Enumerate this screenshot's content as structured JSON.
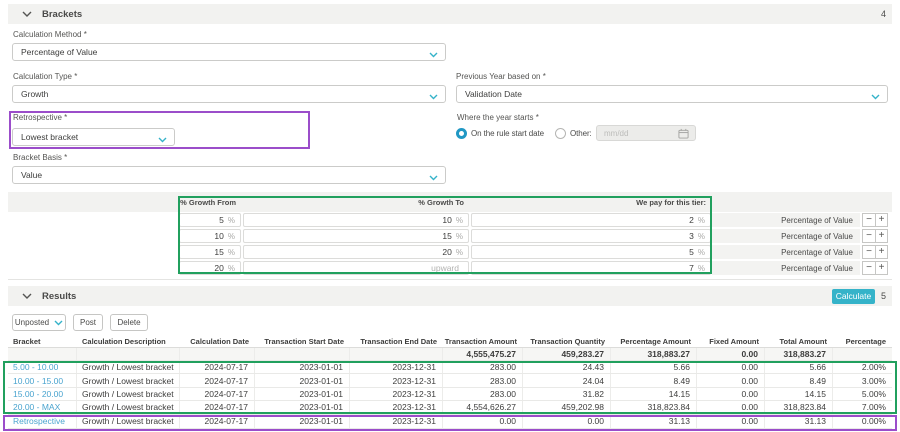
{
  "colors": {
    "accent_teal": "#35b3c9",
    "link_blue": "#4aa4cf",
    "highlight_green": "#21a05e",
    "highlight_purple": "#9b4dca"
  },
  "brackets": {
    "title": "Brackets",
    "count": "4",
    "calculation_method": {
      "label": "Calculation Method *",
      "value": "Percentage of Value"
    },
    "calculation_type": {
      "label": "Calculation Type *",
      "value": "Growth"
    },
    "previous_year": {
      "label": "Previous Year based on *",
      "value": "Validation Date"
    },
    "retrospective": {
      "label": "Retrospective *",
      "value": "Lowest bracket"
    },
    "where_year_starts": {
      "label": "Where the year starts *",
      "option_rule_start": "On the rule start date",
      "option_other": "Other:",
      "date_placeholder": "mm/dd"
    },
    "bracket_basis": {
      "label": "Bracket Basis *",
      "value": "Value"
    },
    "tiers": {
      "col_from": "% Growth From",
      "col_to": "% Growth To",
      "col_pay": "We pay for this tier:",
      "unit": "%",
      "minus": "−",
      "plus": "+",
      "rows": [
        {
          "from": "5",
          "to": "10",
          "to_state": "filled",
          "to_unit": "%",
          "pay": "2",
          "method": "Percentage of Value"
        },
        {
          "from": "10",
          "to": "15",
          "to_state": "filled",
          "to_unit": "%",
          "pay": "3",
          "method": "Percentage of Value"
        },
        {
          "from": "15",
          "to": "20",
          "to_state": "filled",
          "to_unit": "%",
          "pay": "5",
          "method": "Percentage of Value"
        },
        {
          "from": "20",
          "to": "upward",
          "to_state": "placeholder",
          "to_unit": "",
          "pay": "7",
          "method": "Percentage of Value"
        }
      ]
    }
  },
  "results": {
    "title": "Results",
    "count": "5",
    "calculate": "Calculate",
    "status_filter": "Unposted",
    "post": "Post",
    "delete": "Delete",
    "table": {
      "headers": [
        "Bracket",
        "Calculation Description",
        "Calculation Date",
        "Transaction Start Date",
        "Transaction End Date",
        "Transaction Amount",
        "Transaction Quantity",
        "Percentage Amount",
        "Fixed Amount",
        "Total Amount",
        "Percentage"
      ],
      "summary": {
        "transaction_amount": "4,555,475.27",
        "transaction_quantity": "459,283.27",
        "percentage_amount": "318,883.27",
        "fixed_amount": "0.00",
        "total_amount": "318,883.27"
      },
      "rows": [
        {
          "bracket": "5.00 - 10.00",
          "description": "Growth / Lowest bracket",
          "calc_date": "2024-07-17",
          "start_date": "2023-01-01",
          "end_date": "2023-12-31",
          "amount": "283.00",
          "quantity": "24.43",
          "pct_amount": "5.66",
          "fixed": "0.00",
          "total": "5.66",
          "pct": "2.00%"
        },
        {
          "bracket": "10.00 - 15.00",
          "description": "Growth / Lowest bracket",
          "calc_date": "2024-07-17",
          "start_date": "2023-01-01",
          "end_date": "2023-12-31",
          "amount": "283.00",
          "quantity": "24.04",
          "pct_amount": "8.49",
          "fixed": "0.00",
          "total": "8.49",
          "pct": "3.00%"
        },
        {
          "bracket": "15.00 - 20.00",
          "description": "Growth / Lowest bracket",
          "calc_date": "2024-07-17",
          "start_date": "2023-01-01",
          "end_date": "2023-12-31",
          "amount": "283.00",
          "quantity": "31.82",
          "pct_amount": "14.15",
          "fixed": "0.00",
          "total": "14.15",
          "pct": "5.00%"
        },
        {
          "bracket": "20.00 - MAX",
          "description": "Growth / Lowest bracket",
          "calc_date": "2024-07-17",
          "start_date": "2023-01-01",
          "end_date": "2023-12-31",
          "amount": "4,554,626.27",
          "quantity": "459,202.98",
          "pct_amount": "318,823.84",
          "fixed": "0.00",
          "total": "318,823.84",
          "pct": "7.00%"
        }
      ],
      "retro_row": {
        "bracket": "Retrospective",
        "description": "Growth / Lowest bracket",
        "calc_date": "2024-07-17",
        "start_date": "2023-01-01",
        "end_date": "2023-12-31",
        "amount": "0.00",
        "quantity": "0.00",
        "pct_amount": "31.13",
        "fixed": "0.00",
        "total": "31.13",
        "pct": "0.00%"
      }
    }
  }
}
